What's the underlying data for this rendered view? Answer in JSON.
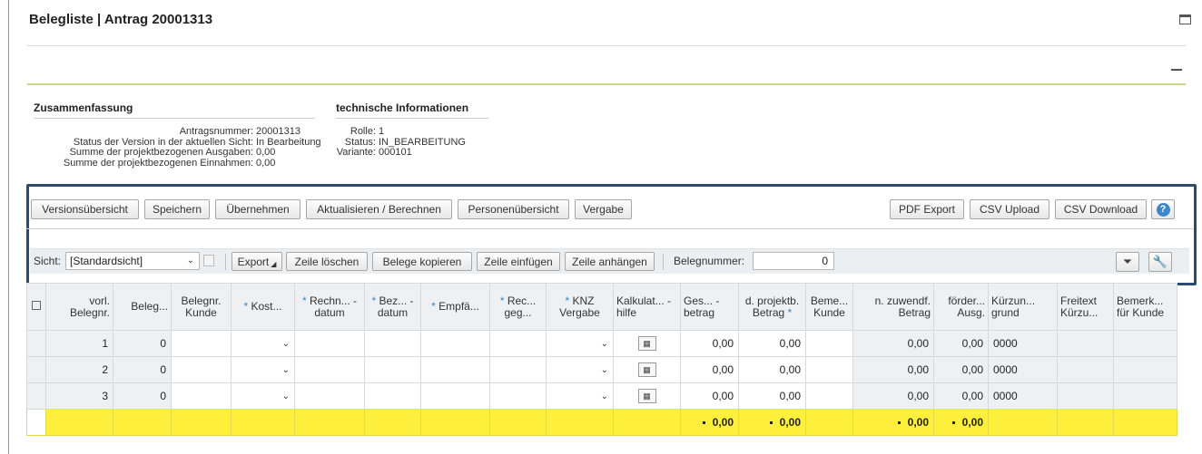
{
  "page": {
    "title": "Belegliste | Antrag 20001313"
  },
  "summary": {
    "title": "Zusammenfassung",
    "rows": [
      {
        "label": "Antragsnummer:",
        "value": "20001313"
      },
      {
        "label": "Status der Version in der aktuellen Sicht:",
        "value": "In Bearbeitung"
      },
      {
        "label": "Summe der projektbezogenen Ausgaben:",
        "value": "0,00"
      },
      {
        "label": "Summe der projektbezogenen Einnahmen:",
        "value": "0,00"
      }
    ]
  },
  "tech": {
    "title": "technische Informationen",
    "rows": [
      {
        "label": "Rolle:",
        "value": "1"
      },
      {
        "label": "Status:",
        "value": "IN_BEARBEITUNG"
      },
      {
        "label": "Variante:",
        "value": "000101"
      }
    ]
  },
  "toolbar": {
    "versions": "Versionsübersicht",
    "save": "Speichern",
    "apply": "Übernehmen",
    "refresh": "Aktualisieren / Berechnen",
    "persons": "Personenübersicht",
    "award": "Vergabe",
    "pdf": "PDF Export",
    "csv_upload": "CSV Upload",
    "csv_download": "CSV Download",
    "help": "?"
  },
  "grid_toolbar": {
    "view_label": "Sicht:",
    "view_value": "[Standardsicht]",
    "export": "Export",
    "delete_row": "Zeile löschen",
    "copy_docs": "Belege kopieren",
    "insert_row": "Zeile einfügen",
    "append_row": "Zeile anhängen",
    "docnum_label": "Belegnummer:",
    "docnum_value": "0"
  },
  "columns": [
    "vorl. Belegnr.",
    "Beleg...",
    "Belegnr. Kunde",
    "Kost...",
    "Rechn... - datum",
    "Bez... - datum",
    "Empfä...",
    "Rec... geg...",
    "KNZ Vergabe",
    "Kalkulat... - hilfe",
    "Ges... - betrag",
    "d. projektb. Betrag",
    "Beme... Kunde",
    "n. zuwendf. Betrag",
    "förder... Ausg.",
    "Kürzun... grund",
    "Freitext Kürzu...",
    "Bemerk... für Kunde"
  ],
  "rows": [
    {
      "vorl": "1",
      "beleg": "0",
      "ges": "0,00",
      "proj": "0,00",
      "zuw": "0,00",
      "foerd": "0,00",
      "kuerz": "0000"
    },
    {
      "vorl": "2",
      "beleg": "0",
      "ges": "0,00",
      "proj": "0,00",
      "zuw": "0,00",
      "foerd": "0,00",
      "kuerz": "0000"
    },
    {
      "vorl": "3",
      "beleg": "0",
      "ges": "0,00",
      "proj": "0,00",
      "zuw": "0,00",
      "foerd": "0,00",
      "kuerz": "0000"
    }
  ],
  "totals": {
    "ges": "0,00",
    "proj": "0,00",
    "zuw": "0,00",
    "foerd": "0,00"
  },
  "colors": {
    "highlight_border": "#2e4a6e",
    "sum_row": "#ffef3d",
    "accent_rule": "#c5d88a",
    "required_marker": "#3a87c9"
  },
  "icons": [
    "maximize-icon",
    "collapse-icon",
    "help-icon",
    "save-view-icon",
    "filter-icon",
    "settings-icon",
    "calculator-icon",
    "select-all-icon"
  ]
}
